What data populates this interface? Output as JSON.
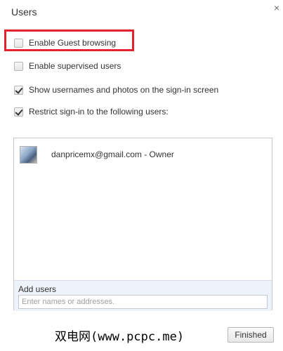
{
  "dialog": {
    "title": "Users",
    "close_glyph": "×",
    "close_icon": "close-icon"
  },
  "options": [
    {
      "label": "Enable Guest browsing",
      "checked": false,
      "highlighted": true
    },
    {
      "label": "Enable supervised users",
      "checked": false
    },
    {
      "label": "Show usernames and photos on the sign-in screen",
      "checked": true
    },
    {
      "label": "Restrict sign-in to the following users:",
      "checked": true
    }
  ],
  "users_list": {
    "users": [
      {
        "name": "danpricemx@gmail.com - Owner"
      }
    ]
  },
  "add_users": {
    "label": "Add users",
    "placeholder": "Enter names or addresses."
  },
  "watermark": "双电网(www.pcpc.me)",
  "footer": {
    "finished_label": "Finished"
  },
  "colors": {
    "highlight": "#e5232f",
    "add_users_bg": "#eef2fb"
  }
}
